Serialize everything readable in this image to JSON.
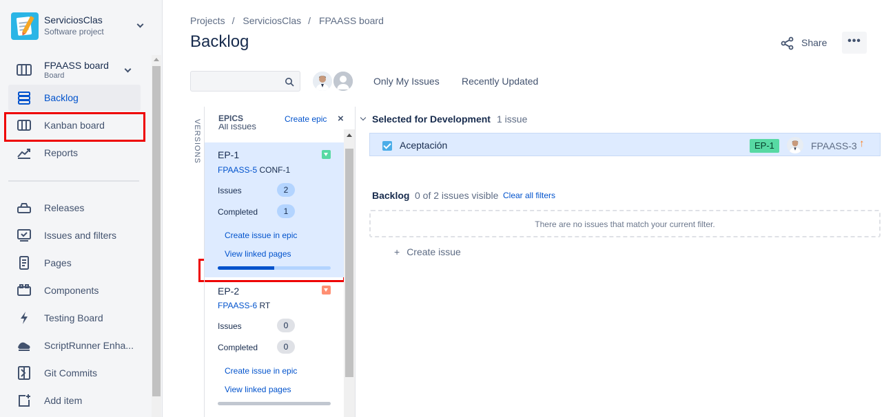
{
  "project": {
    "name": "ServiciosClas",
    "type": "Software project"
  },
  "board": {
    "name": "FPAASS board",
    "type": "Board"
  },
  "nav": [
    {
      "label": "Backlog",
      "icon": "backlog-icon",
      "active": true
    },
    {
      "label": "Kanban board",
      "icon": "kanban-icon"
    },
    {
      "label": "Reports",
      "icon": "reports-icon"
    },
    {
      "label": "Releases",
      "icon": "releases-icon"
    },
    {
      "label": "Issues and filters",
      "icon": "issues-icon"
    },
    {
      "label": "Pages",
      "icon": "pages-icon"
    },
    {
      "label": "Components",
      "icon": "components-icon"
    },
    {
      "label": "Testing Board",
      "icon": "testing-board-icon"
    },
    {
      "label": "ScriptRunner Enha...",
      "icon": "scriptrunner-icon"
    },
    {
      "label": "Git Commits",
      "icon": "git-commits-icon"
    },
    {
      "label": "Add item",
      "icon": "add-item-icon"
    }
  ],
  "breadcrumb": [
    "Projects",
    "ServiciosClas",
    "FPAASS board"
  ],
  "page": {
    "title": "Backlog",
    "share_label": "Share",
    "more_label": "•••"
  },
  "filters": {
    "search_placeholder": "",
    "only_my_issues": "Only My Issues",
    "recently_updated": "Recently Updated"
  },
  "epics_panel": {
    "versions_label": "VERSIONS",
    "heading": "EPICS",
    "create_epic": "Create epic",
    "close": "×",
    "all_issues": "All issues",
    "epics": [
      {
        "name": "EP-1",
        "key": "FPAASS-5",
        "summary": "CONF-1",
        "color": "#57d9a3",
        "issues_label": "Issues",
        "issues": "2",
        "completed_label": "Completed",
        "completed": "1",
        "create_link": "Create issue in epic",
        "pages_link": "View linked pages",
        "progress": 0.5
      },
      {
        "name": "EP-2",
        "key": "FPAASS-6",
        "summary": "RT",
        "color": "#ff8f73",
        "issues_label": "Issues",
        "issues": "0",
        "completed_label": "Completed",
        "completed": "0",
        "create_link": "Create issue in epic",
        "pages_link": "View linked pages",
        "progress": 0
      }
    ]
  },
  "sprint": {
    "title": "Selected for Development",
    "count": "1 issue",
    "issues": [
      {
        "summary": "Aceptación",
        "epic": "EP-1",
        "key": "FPAASS-3",
        "priority": "↑"
      }
    ]
  },
  "backlog": {
    "title": "Backlog",
    "count": "0 of 2 issues visible",
    "clear_filters": "Clear all filters",
    "empty_message": "There are no issues that match your current filter.",
    "create_issue": "Create issue",
    "create_plus": "+"
  },
  "colors": {
    "accent": "#0052cc",
    "highlight": "#deebff",
    "annotation": "#ee0000"
  }
}
